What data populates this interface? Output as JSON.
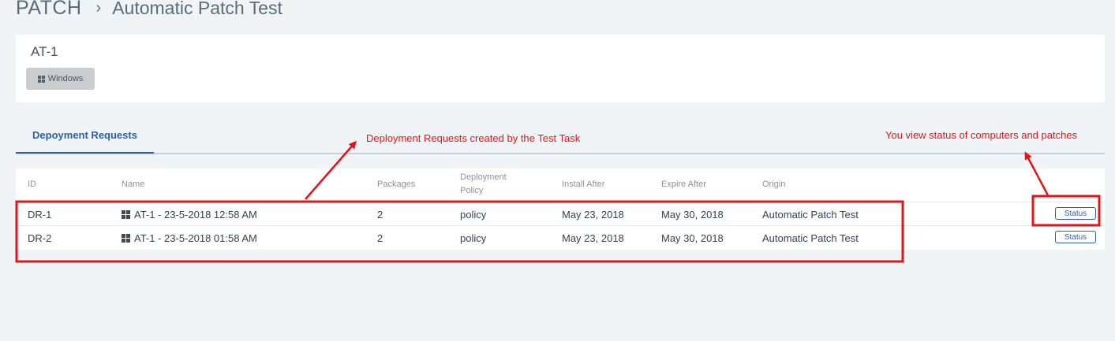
{
  "breadcrumb": {
    "root": "PATCH",
    "separator": "›",
    "current": "Automatic Patch Test"
  },
  "task": {
    "name": "AT-1",
    "os_badge": {
      "icon": "windows-icon",
      "label": "Windows"
    }
  },
  "tabs": [
    {
      "label": "Depoyment Requests",
      "active": true
    }
  ],
  "table": {
    "headers": {
      "id": "ID",
      "name": "Name",
      "packages": "Packages",
      "policy_line1": "Deployment",
      "policy_line2": "Policy",
      "install_after": "Install After",
      "expire_after": "Expire After",
      "origin": "Origin"
    },
    "rows": [
      {
        "id": "DR-1",
        "name": "AT-1 - 23-5-2018 12:58 AM",
        "packages": "2",
        "policy": "policy",
        "install_after": "May 23, 2018",
        "expire_after": "May 30, 2018",
        "origin": "Automatic Patch Test",
        "action": "Status"
      },
      {
        "id": "DR-2",
        "name": "AT-1 - 23-5-2018 01:58 AM",
        "packages": "2",
        "policy": "policy",
        "install_after": "May 23, 2018",
        "expire_after": "May 30, 2018",
        "origin": "Automatic Patch Test",
        "action": "Status"
      }
    ]
  },
  "annotations": {
    "deployment_note": "Deployment Requests created by the Test Task",
    "status_note": "You view status of computers and patches",
    "color": "#e0161a"
  },
  "colors": {
    "accent": "#2d5fa8",
    "background": "#f0f4f7"
  }
}
